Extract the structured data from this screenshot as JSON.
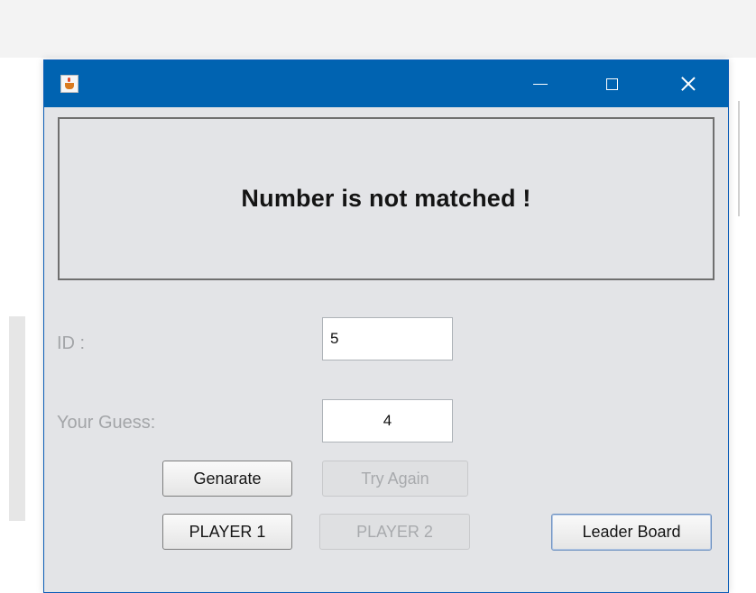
{
  "window": {
    "icon": "java-cup-icon",
    "controls": {
      "minimize": "minimize-icon",
      "maximize": "maximize-icon",
      "close": "close-icon"
    },
    "titlebar_color": "#0063B1"
  },
  "message": "Number is not matched !",
  "form": {
    "id_label": "ID :",
    "id_value": "5",
    "guess_label": "Your Guess:",
    "guess_value": "4"
  },
  "buttons": {
    "genarate": "Genarate",
    "try_again": "Try Again",
    "player1": "PLAYER 1",
    "player2": "PLAYER 2",
    "leader_board": "Leader Board"
  }
}
